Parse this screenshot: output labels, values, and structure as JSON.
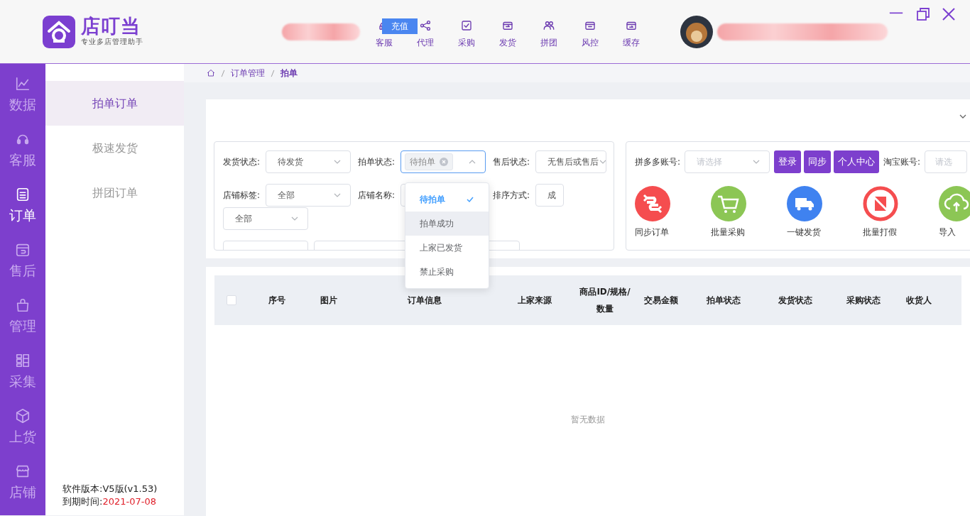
{
  "logo": {
    "name": "店叮当",
    "tagline": "专业多店管理助手"
  },
  "top_nav": [
    {
      "label": "客服",
      "selected": false
    },
    {
      "label": "代理",
      "selected": false
    },
    {
      "label": "采购",
      "selected": false
    },
    {
      "label": "发货",
      "selected": false
    },
    {
      "label": "拼团",
      "selected": false
    },
    {
      "label": "风控",
      "selected": false
    },
    {
      "label": "缓存",
      "selected": false
    }
  ],
  "recharge_button": "充值",
  "rail": [
    {
      "label": "数据",
      "selected": false
    },
    {
      "label": "客服",
      "selected": false
    },
    {
      "label": "订单",
      "selected": true
    },
    {
      "label": "售后",
      "selected": false
    },
    {
      "label": "管理",
      "selected": false
    },
    {
      "label": "采集",
      "selected": false
    },
    {
      "label": "上货",
      "selected": false
    },
    {
      "label": "店铺",
      "selected": false
    }
  ],
  "submenu": [
    {
      "label": "拍单订单",
      "selected": true
    },
    {
      "label": "极速发货",
      "selected": false
    },
    {
      "label": "拼团订单",
      "selected": false
    }
  ],
  "footer": {
    "version": "软件版本:V5版(v1.53)",
    "expiry_label": "到期时间:",
    "expiry_date": "2021-07-08"
  },
  "breadcrumb": [
    "订单管理",
    "拍单"
  ],
  "filters": [
    [
      {
        "kind": "select",
        "label": "发货状态:",
        "value": "待发货"
      },
      {
        "kind": "tag-select",
        "label": "拍单状态:",
        "value": "待拍单",
        "open": true
      },
      {
        "kind": "select",
        "label": "售后状态:",
        "value": "无售后或售后"
      }
    ],
    [
      {
        "kind": "select",
        "label": "店铺标签:",
        "value": "全部"
      },
      {
        "kind": "select",
        "label": "店铺名称:"
      },
      {
        "kind": "select",
        "label": "排序方式:",
        "value": "成"
      }
    ],
    [
      {
        "kind": "select",
        "value": "全部"
      }
    ],
    [
      {
        "kind": "select"
      },
      {
        "kind": "wide-select"
      }
    ]
  ],
  "dropdown": [
    {
      "label": "待拍单",
      "selected": true,
      "hovered": false
    },
    {
      "label": "拍单成功",
      "selected": false,
      "hovered": true
    },
    {
      "label": "上家已发货",
      "selected": false,
      "hovered": false
    },
    {
      "label": "禁止采购",
      "selected": false,
      "hovered": false
    }
  ],
  "accounts": {
    "pdd_label": "拼多多账号:",
    "pdd_placeholder": "请选择",
    "buttons": [
      "登录",
      "同步",
      "个人中心"
    ],
    "taobao_label": "淘宝账号:",
    "taobao_placeholder": "请选"
  },
  "actions": [
    {
      "label": "同步订单",
      "color": "#f54d4f"
    },
    {
      "label": "批量采购",
      "color": "#8cc655"
    },
    {
      "label": "一键发货",
      "color": "#3f82f0"
    },
    {
      "label": "批量打假",
      "color": "#f54d4f"
    },
    {
      "label": "导入",
      "color": "#8cc655"
    }
  ],
  "table": {
    "columns": [
      "序号",
      "图片",
      "订单信息",
      "上家来源",
      "商品ID/规格/数量",
      "交易金额",
      "拍单状态",
      "发货状态",
      "采购状态",
      "收货人"
    ],
    "all_checked": false,
    "empty_text": "暂无数据"
  }
}
